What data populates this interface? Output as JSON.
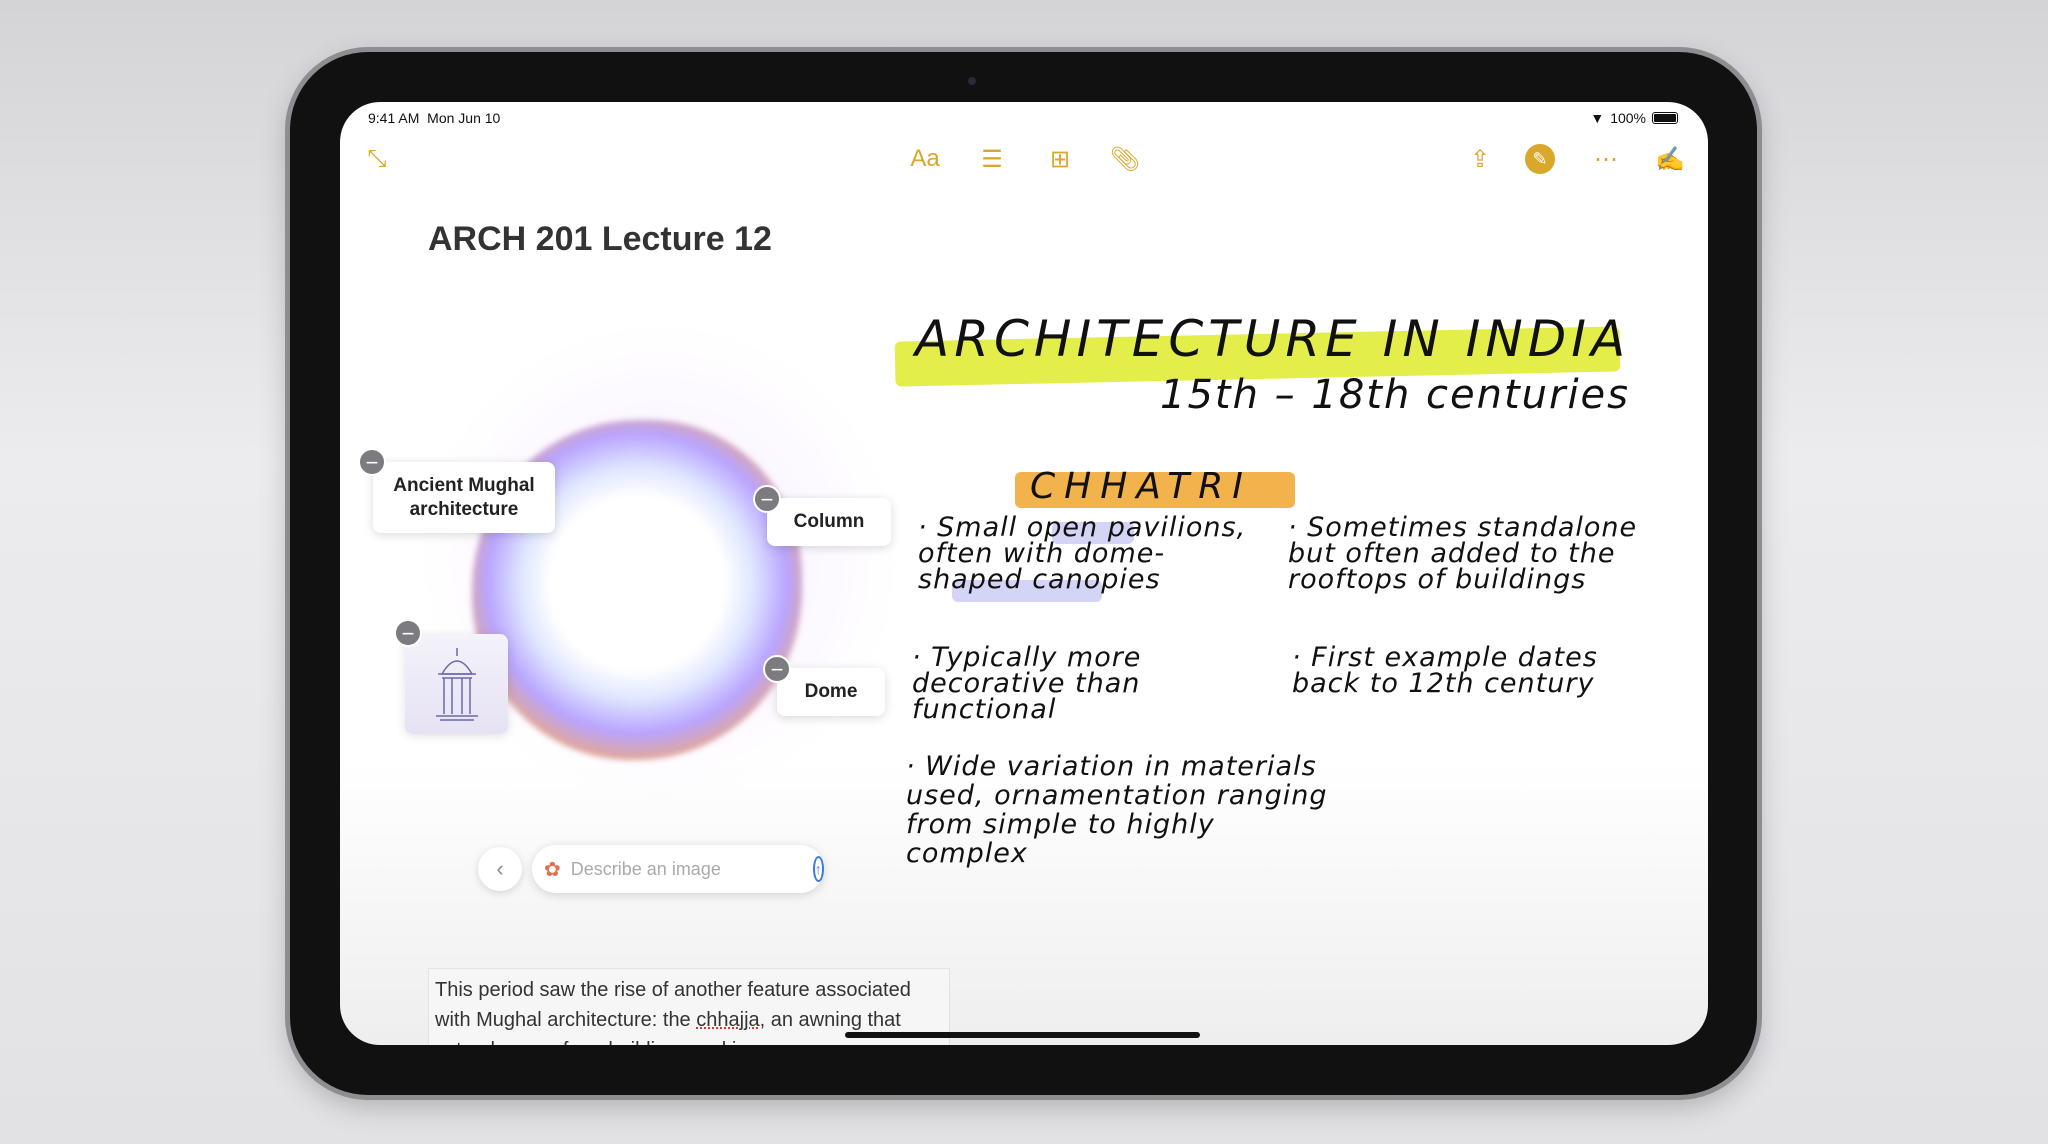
{
  "status": {
    "time": "9:41 AM",
    "date": "Mon Jun 10",
    "battery": "100%",
    "battery_level": 1.0
  },
  "toolbar": {
    "collapse": "collapse-icon",
    "format": "Aa",
    "checklist": "checklist-icon",
    "table": "table-icon",
    "attach": "paperclip-icon",
    "share": "share-icon",
    "markup": "markup-icon",
    "more": "more-icon",
    "compose": "compose-icon",
    "accent": "#d9a82a"
  },
  "note": {
    "title": "ARCH 201 Lecture 12"
  },
  "image_playground": {
    "tags": [
      "Ancient Mughal architecture",
      "Column",
      "Dome"
    ],
    "prompt_placeholder": "Describe an image"
  },
  "handwriting": {
    "heading": "ARCHITECTURE IN INDIA",
    "subheading": "15th – 18th centuries",
    "section": "CHHATRI",
    "bullets": [
      "Small open pavilions, often with dome-shaped canopies",
      "Sometimes standalone but often added to the rooftops of buildings",
      "Typically more decorative than functional",
      "First example dates back to 12th century",
      "Wide variation in materials used, ornamentation ranging from simple to highly complex"
    ],
    "highlight_colors": {
      "heading": "#e4ee4a",
      "section": "#f2b24c",
      "phrases": "#c9c9f4"
    }
  },
  "paragraph": {
    "before": "This period saw the rise of another feature associated with Mughal architecture: the ",
    "word": "chhajja",
    "after": ", an awning that extends away from buildings and is"
  }
}
